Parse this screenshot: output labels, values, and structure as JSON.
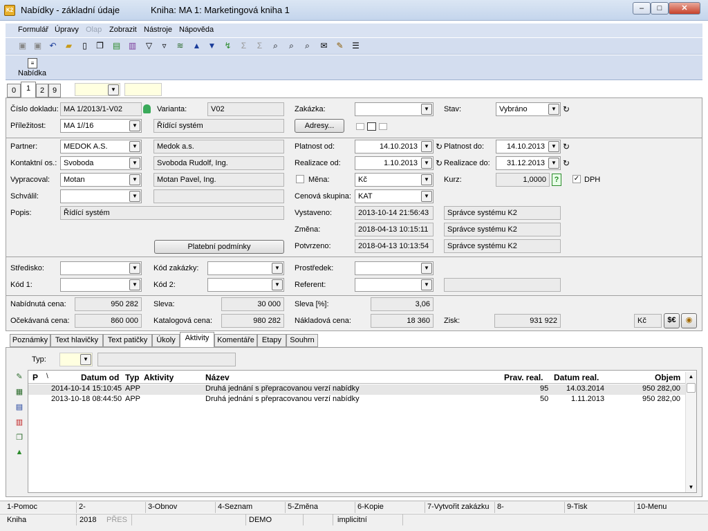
{
  "window": {
    "title": "Nabídky - základní údaje",
    "book": "Kniha: MA 1: Marketingová kniha 1"
  },
  "menu": [
    "Formulář",
    "Úpravy",
    "Olap",
    "Zobrazit",
    "Nástroje",
    "Nápověda"
  ],
  "bigtoolbar": {
    "label": "Nabídka"
  },
  "top_tabs": [
    "0",
    "1",
    "2",
    "9"
  ],
  "form": {
    "cislo_dokladu_label": "Číslo dokladu:",
    "cislo_dokladu": "MA 1/2013/1-V02",
    "varianta_label": "Varianta:",
    "varianta": "V02",
    "zakazka_label": "Zakázka:",
    "stav_label": "Stav:",
    "stav": "Vybráno",
    "prilezitost_label": "Příležitost:",
    "prilezitost": "MA 1//16",
    "prilezitost_name": "Řídící systém",
    "adresy_button": "Adresy...",
    "partner_label": "Partner:",
    "partner": "MEDOK A.S.",
    "partner_name": "Medok a.s.",
    "platnost_od_label": "Platnost od:",
    "platnost_od": "14.10.2013",
    "platnost_do_label": "Platnost do:",
    "platnost_do": "14.10.2013",
    "kontaktni_label": "Kontaktní os.:",
    "kontaktni": "Svoboda",
    "kontaktni_name": "Svoboda Rudolf, Ing.",
    "realizace_od_label": "Realizace od:",
    "realizace_od": "1.10.2013",
    "realizace_do_label": "Realizace do:",
    "realizace_do": "31.12.2013",
    "vypracoval_label": "Vypracoval:",
    "vypracoval": "Motan",
    "vypracoval_name": "Motan Pavel, Ing.",
    "mena_label": "Měna:",
    "mena": "Kč",
    "kurz_label": "Kurz:",
    "kurz": "1,0000",
    "dph_label": "DPH",
    "schvalil_label": "Schválil:",
    "cenova_skupina_label": "Cenová skupina:",
    "cenova_skupina": "KAT",
    "popis_label": "Popis:",
    "popis": "Řídící systém",
    "vystaveno_label": "Vystaveno:",
    "vystaveno": "2013-10-14 21:56:43",
    "vystaveno_user": "Správce systému K2",
    "zmena_label": "Změna:",
    "zmena": "2018-04-13 10:15:11",
    "zmena_user": "Správce systému K2",
    "potvrzeno_label": "Potvrzeno:",
    "potvrzeno": "2018-04-13 10:13:54",
    "potvrzeno_user": "Správce systému K2",
    "platebni_button": "Platební podmínky",
    "stredisko_label": "Středisko:",
    "kod_zakazky_label": "Kód zakázky:",
    "prostredek_label": "Prostředek:",
    "kod1_label": "Kód 1:",
    "kod2_label": "Kód 2:",
    "referent_label": "Referent:",
    "nabidnuta_label": "Nabídnutá cena:",
    "nabidnuta": "950 282",
    "sleva_label": "Sleva:",
    "sleva": "30 000",
    "sleva_pct_label": "Sleva [%]:",
    "sleva_pct": "3,06",
    "ocekavana_label": "Očekávaná cena:",
    "ocekavana": "860 000",
    "katalogova_label": "Katalogová cena:",
    "katalogova": "980 282",
    "nakladova_label": "Nákladová cena:",
    "nakladova": "18 360",
    "zisk_label": "Zisk:",
    "zisk": "931 922",
    "currency": "Kč"
  },
  "bottom_tabs": [
    "Poznámky",
    "Text hlavičky",
    "Text patičky",
    "Úkoly",
    "Aktivity",
    "Komentáře",
    "Etapy",
    "Souhrn"
  ],
  "aktivity": {
    "typ_label": "Typ:",
    "columns": [
      "P",
      "\\",
      "Datum od",
      "Typ",
      "Aktivity",
      "Název",
      "Prav. real.",
      "Datum real.",
      "Objem"
    ],
    "rows": [
      {
        "datum_od": "2014-10-14 15:10:45",
        "typ": "APP",
        "nazev": "Druhá jednání s přepracovanou verzí nabídky",
        "prav": "95",
        "datum_real": "14.03.2014",
        "objem": "950 282,00"
      },
      {
        "datum_od": "2013-10-18 08:44:50",
        "typ": "APP",
        "nazev": "Druhá jednání s přepracovanou verzí nabídky",
        "prav": "50",
        "datum_real": "1.11.2013",
        "objem": "950 282,00"
      }
    ]
  },
  "fkeys": [
    "1-Pomoc",
    "2-",
    "3-Obnov",
    "4-Seznam",
    "5-Změna",
    "6-Kopie",
    "7-Vytvořit zakázku",
    "8-",
    "9-Tisk",
    "10-Menu"
  ],
  "status": {
    "kniha": "Kniha",
    "year": "2018",
    "pres": "PŘES",
    "demo": "DEMO",
    "implicitni": "implicitní"
  }
}
